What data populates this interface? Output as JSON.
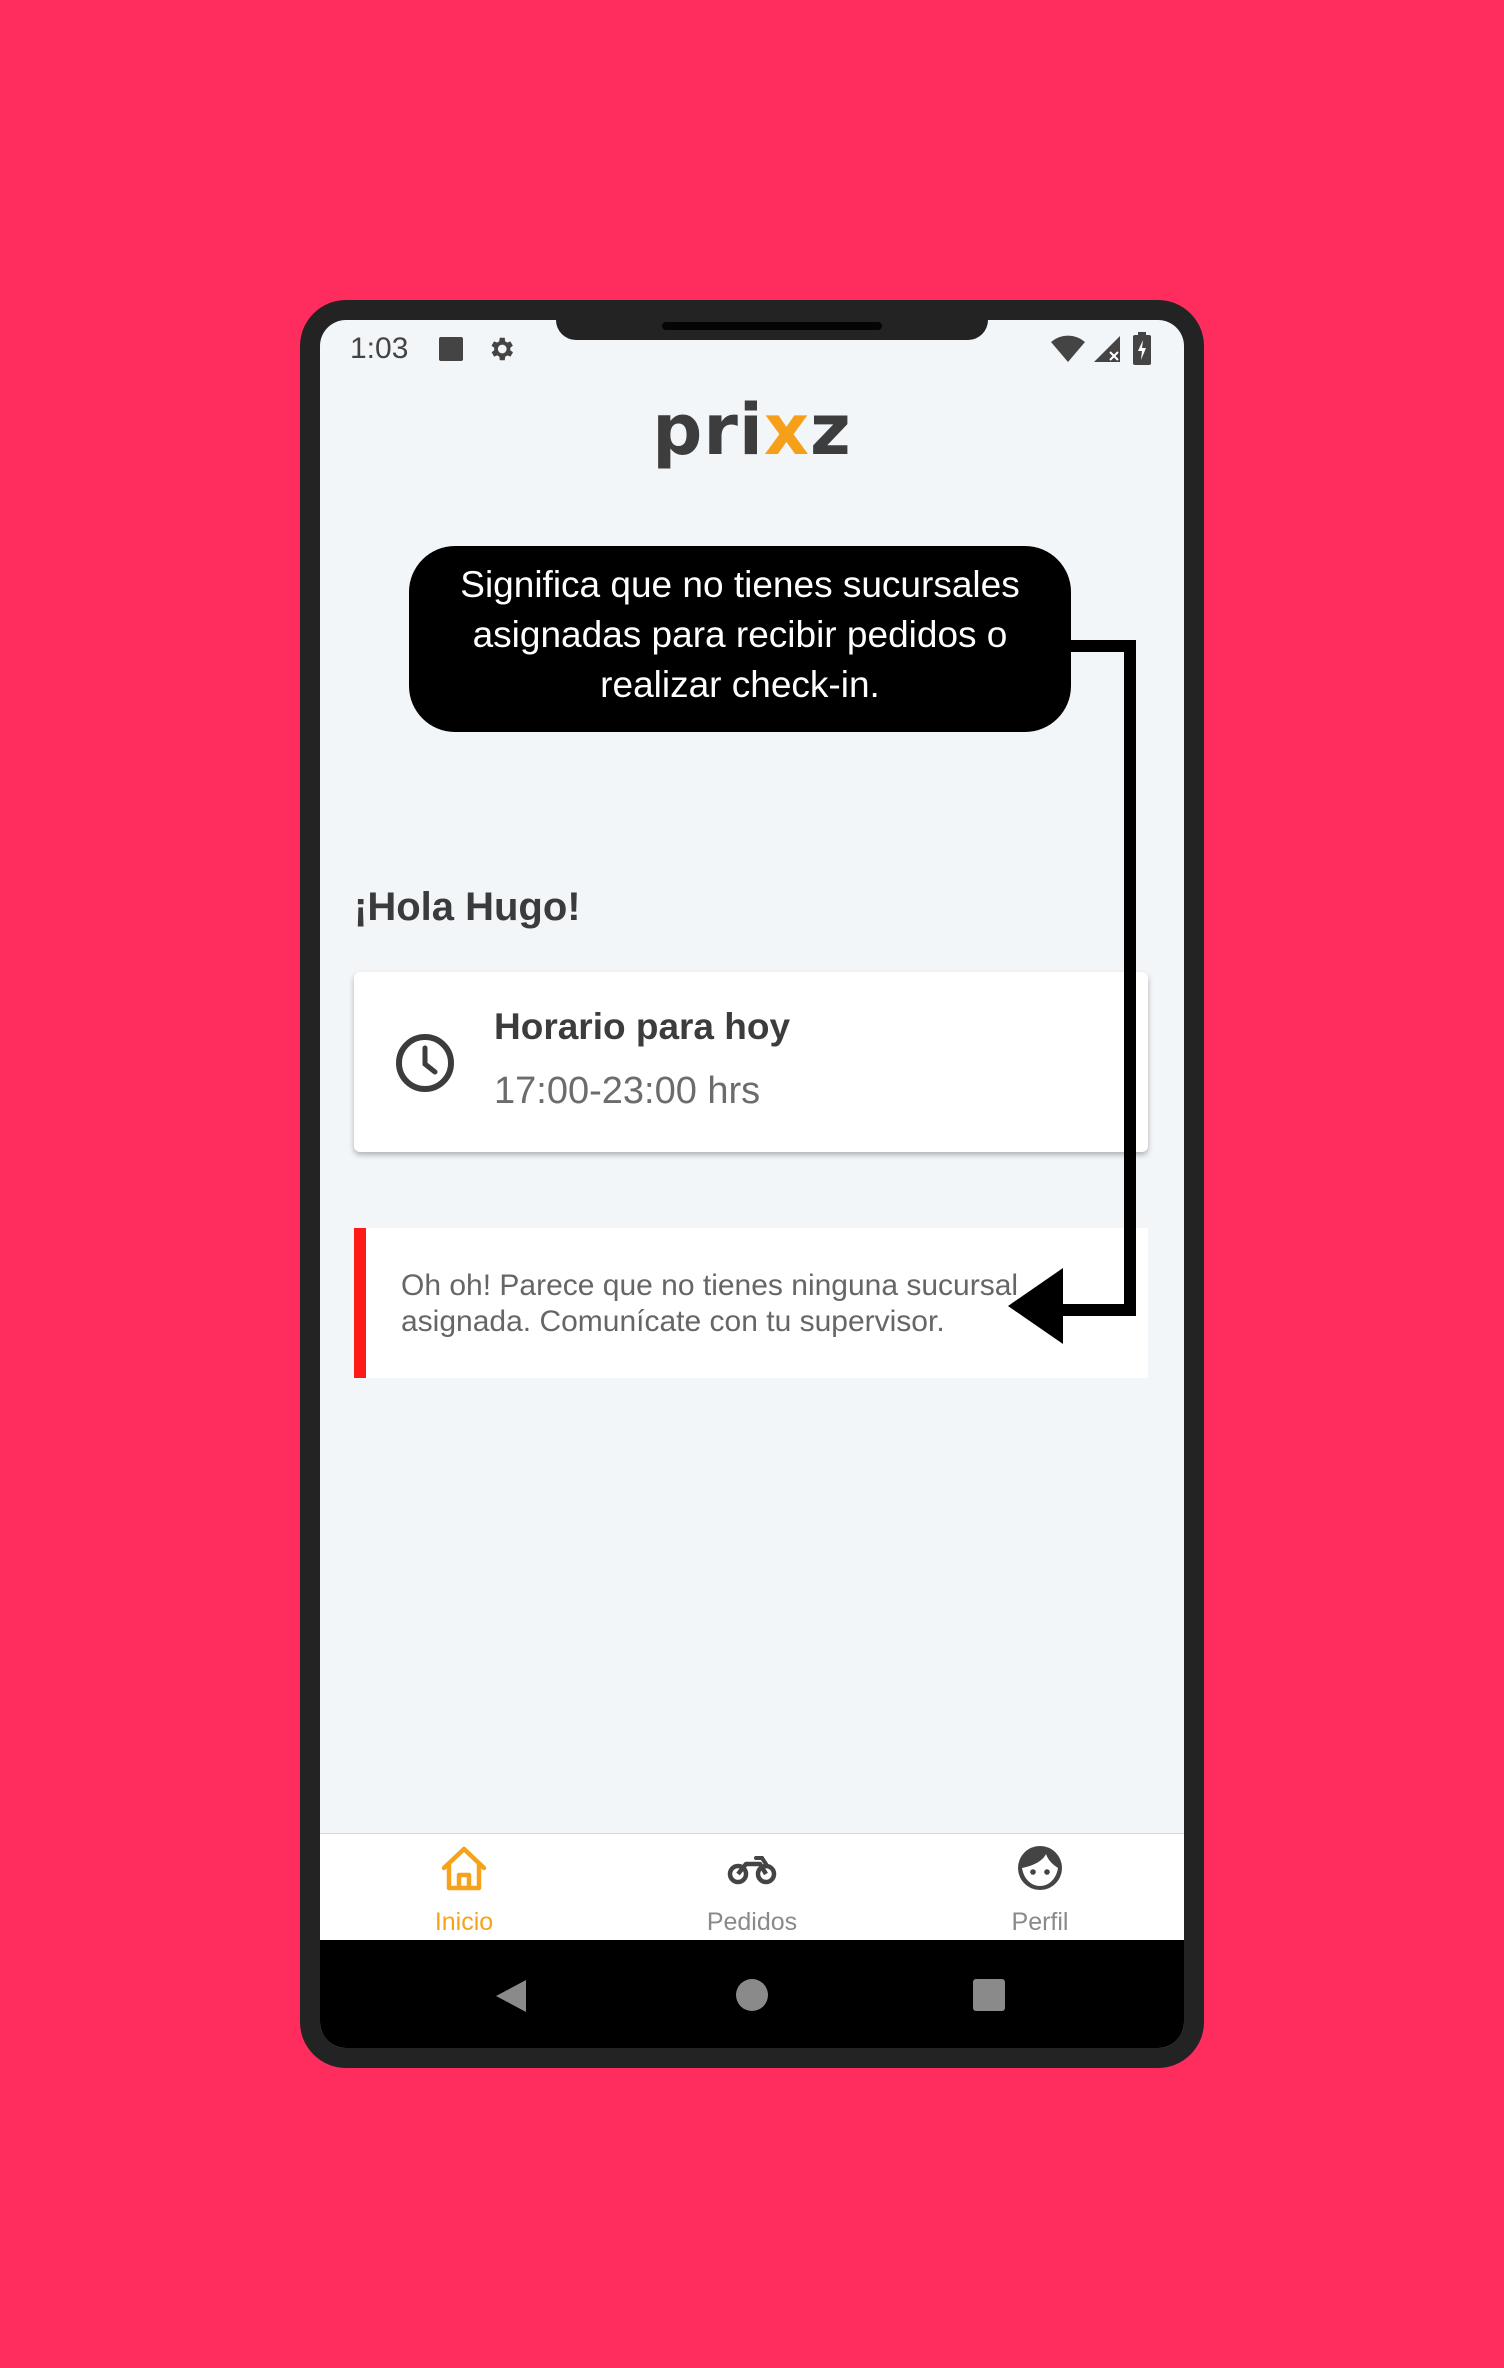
{
  "status_bar": {
    "time": "1:03",
    "icons": [
      "square-notification-icon",
      "gear-icon",
      "wifi-icon",
      "signal-icon",
      "battery-icon"
    ]
  },
  "app": {
    "logo_text_left": "pri",
    "logo_text_accent": "x",
    "logo_text_right": "z",
    "accent_color": "#f6a01a"
  },
  "tooltip": {
    "text": "Significa que no tienes sucursales asignadas para recibir pedidos o realizar check-in."
  },
  "main": {
    "greeting": "¡Hola Hugo!",
    "schedule": {
      "icon": "clock-icon",
      "title": "Horario para hoy",
      "hours": "17:00-23:00 hrs"
    },
    "alert": {
      "text": "Oh oh! Parece que no tienes ninguna sucursal asignada. Comunícate con tu supervisor.",
      "bar_color": "#ff1a1a"
    }
  },
  "bottom_nav": {
    "items": [
      {
        "label": "Inicio",
        "icon": "home-icon",
        "active": true
      },
      {
        "label": "Pedidos",
        "icon": "motorbike-icon",
        "active": false
      },
      {
        "label": "Perfil",
        "icon": "face-icon",
        "active": false
      }
    ]
  },
  "system_nav": {
    "buttons": [
      "back-icon",
      "home-circle-icon",
      "recents-icon"
    ]
  },
  "colors": {
    "background": "#ff2d5e",
    "active_nav": "#f5a31a"
  }
}
